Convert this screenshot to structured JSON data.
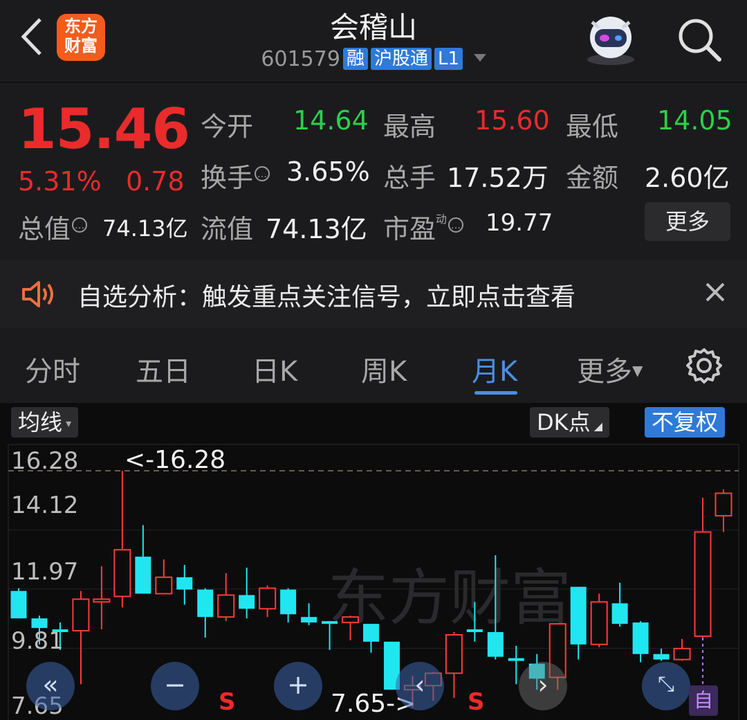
{
  "header": {
    "logo_line1": "东方",
    "logo_line2": "财富",
    "title": "会稽山",
    "code": "601579",
    "tags": [
      "融",
      "沪股通",
      "L1"
    ]
  },
  "quote": {
    "price": "15.46",
    "change_pct": "5.31%",
    "change": "0.78",
    "open_label": "今开",
    "open": "14.64",
    "high_label": "最高",
    "high": "15.60",
    "low_label": "最低",
    "low": "14.05",
    "turnover_label": "换手",
    "turnover": "3.65%",
    "volume_label": "总手",
    "volume": "17.52万",
    "amount_label": "金额",
    "amount": "2.60亿",
    "mktcap_label": "总值",
    "mktcap": "74.13亿",
    "float_label": "流值",
    "float": "74.13亿",
    "pe_label": "市盈",
    "pe_sup": "动",
    "pe": "19.77",
    "more_button": "更多"
  },
  "banner": {
    "text": "自选分析：触发重点关注信号，立即点击查看"
  },
  "tabs": [
    "分时",
    "五日",
    "日K",
    "周K",
    "月K",
    "更多"
  ],
  "active_tab": "月K",
  "chart_toolbar": {
    "ma_dropdown": "均线",
    "dk_button": "DK点",
    "adjust_button": "不复权"
  },
  "chart_data": {
    "type": "candlestick",
    "y_ticks": [
      "16.28",
      "14.12",
      "11.97",
      "9.81",
      "7.65"
    ],
    "ylim": [
      7.65,
      16.28
    ],
    "max_marker": "<-16.28",
    "min_marker": "7.65->",
    "watermark": "东方财富",
    "signal_labels": [
      "S",
      "S"
    ],
    "end_marker": "自",
    "candles": [
      {
        "o": 11.9,
        "c": 10.9,
        "h": 12.0,
        "l": 10.9,
        "up": false
      },
      {
        "o": 10.9,
        "c": 10.55,
        "h": 11.0,
        "l": 9.95,
        "up": false
      },
      {
        "o": 10.5,
        "c": 10.4,
        "h": 10.75,
        "l": 9.75,
        "up": false
      },
      {
        "o": 10.45,
        "c": 11.6,
        "h": 11.9,
        "l": 8.5,
        "up": true
      },
      {
        "o": 11.5,
        "c": 11.6,
        "h": 12.8,
        "l": 10.5,
        "up": true
      },
      {
        "o": 11.7,
        "c": 13.4,
        "h": 16.28,
        "l": 11.3,
        "up": true
      },
      {
        "o": 13.15,
        "c": 11.8,
        "h": 14.3,
        "l": 11.8,
        "up": false
      },
      {
        "o": 11.8,
        "c": 12.4,
        "h": 13.05,
        "l": 11.8,
        "up": true
      },
      {
        "o": 12.4,
        "c": 11.95,
        "h": 12.85,
        "l": 11.4,
        "up": false
      },
      {
        "o": 11.95,
        "c": 10.95,
        "h": 12.0,
        "l": 10.2,
        "up": false
      },
      {
        "o": 10.95,
        "c": 11.75,
        "h": 12.55,
        "l": 10.8,
        "up": true
      },
      {
        "o": 11.75,
        "c": 11.25,
        "h": 12.75,
        "l": 10.9,
        "up": false
      },
      {
        "o": 11.25,
        "c": 12.0,
        "h": 12.1,
        "l": 10.95,
        "up": true
      },
      {
        "o": 11.95,
        "c": 11.05,
        "h": 12.0,
        "l": 10.75,
        "up": false
      },
      {
        "o": 10.95,
        "c": 10.75,
        "h": 11.45,
        "l": 10.65,
        "up": false
      },
      {
        "o": 10.8,
        "c": 10.7,
        "h": 10.8,
        "l": 9.75,
        "up": false
      },
      {
        "o": 10.75,
        "c": 10.95,
        "h": 11.0,
        "l": 10.1,
        "up": true
      },
      {
        "o": 10.7,
        "c": 10.05,
        "h": 10.7,
        "l": 9.65,
        "up": false
      },
      {
        "o": 10.05,
        "c": 8.3,
        "h": 10.05,
        "l": 8.3,
        "up": false
      },
      {
        "o": 8.3,
        "c": 8.45,
        "h": 8.8,
        "l": 7.65,
        "up": true
      },
      {
        "o": 8.45,
        "c": 8.9,
        "h": 8.95,
        "l": 7.9,
        "up": true
      },
      {
        "o": 8.9,
        "c": 10.3,
        "h": 10.4,
        "l": 8.0,
        "up": true
      },
      {
        "o": 10.5,
        "c": 10.4,
        "h": 11.5,
        "l": 10.05,
        "up": false
      },
      {
        "o": 10.4,
        "c": 9.5,
        "h": 13.2,
        "l": 9.4,
        "up": false
      },
      {
        "o": 9.45,
        "c": 9.35,
        "h": 9.9,
        "l": 8.5,
        "up": false
      },
      {
        "o": 9.25,
        "c": 8.7,
        "h": 9.6,
        "l": 8.3,
        "up": false
      },
      {
        "o": 8.75,
        "c": 10.7,
        "h": 10.7,
        "l": 8.3,
        "up": true
      },
      {
        "o": 12.05,
        "c": 9.95,
        "h": 12.05,
        "l": 9.4,
        "up": false
      },
      {
        "o": 9.95,
        "c": 11.5,
        "h": 11.8,
        "l": 9.85,
        "up": true
      },
      {
        "o": 11.45,
        "c": 10.7,
        "h": 12.2,
        "l": 10.6,
        "up": false
      },
      {
        "o": 10.75,
        "c": 9.6,
        "h": 10.8,
        "l": 9.3,
        "up": false
      },
      {
        "o": 9.6,
        "c": 9.4,
        "h": 9.8,
        "l": 9.35,
        "up": false
      },
      {
        "o": 9.4,
        "c": 9.8,
        "h": 10.15,
        "l": 9.35,
        "up": true
      },
      {
        "o": 10.25,
        "c": 14.05,
        "h": 15.3,
        "l": 10.2,
        "up": true
      },
      {
        "o": 14.64,
        "c": 15.46,
        "h": 15.6,
        "l": 14.05,
        "up": true
      }
    ]
  }
}
